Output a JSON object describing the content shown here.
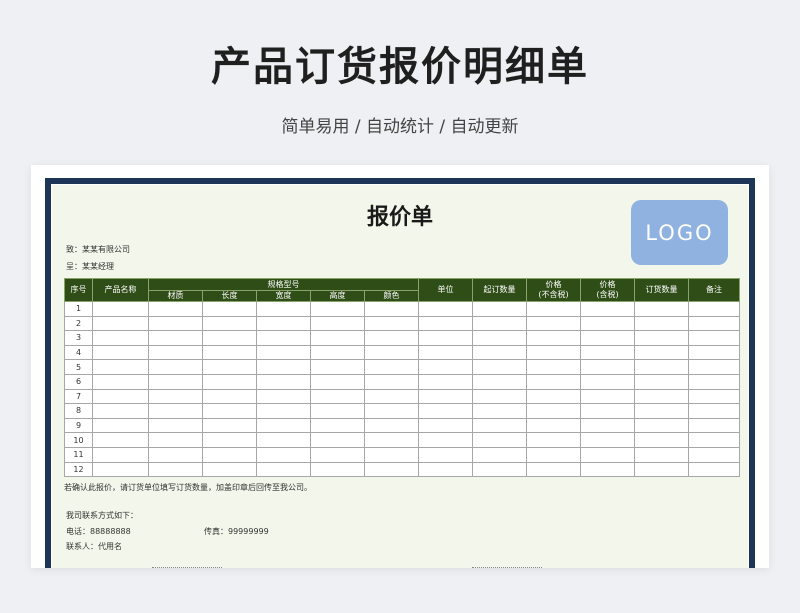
{
  "banner": {
    "title": "产品订货报价明细单",
    "subtitle": "简单易用 / 自动统计 / 自动更新"
  },
  "sheet": {
    "title": "报价单",
    "logo_text": "LOGO",
    "to_line": "致：某某有限公司",
    "attn_line": "呈：某某经理",
    "headers": {
      "seq": "序号",
      "product_name": "产品名称",
      "spec_group": "规格型号",
      "material": "材质",
      "length": "长度",
      "width": "宽度",
      "height": "高度",
      "color": "颜色",
      "unit": "单位",
      "min_qty": "起订数量",
      "price_ex_tax_1": "价格",
      "price_ex_tax_2": "(不含税)",
      "price_inc_tax_1": "价格",
      "price_inc_tax_2": "(含税)",
      "order_qty": "订货数量",
      "remark": "备注"
    },
    "rows": [
      "1",
      "2",
      "3",
      "4",
      "5",
      "6",
      "7",
      "8",
      "9",
      "10",
      "11",
      "12"
    ],
    "note": "若确认此报价，请订货单位填写订货数量，加盖印章后回传至我公司。",
    "contact_heading": "我司联系方式如下：",
    "tel": "电话：88888888",
    "fax": "传真：99999999",
    "contact_person": "联系人：代用名"
  },
  "colors": {
    "frame": "#1d3557",
    "header_fill": "#2f4d17",
    "sheet_bg": "#f3f6ea",
    "logo_bg": "#8fb2e0"
  }
}
